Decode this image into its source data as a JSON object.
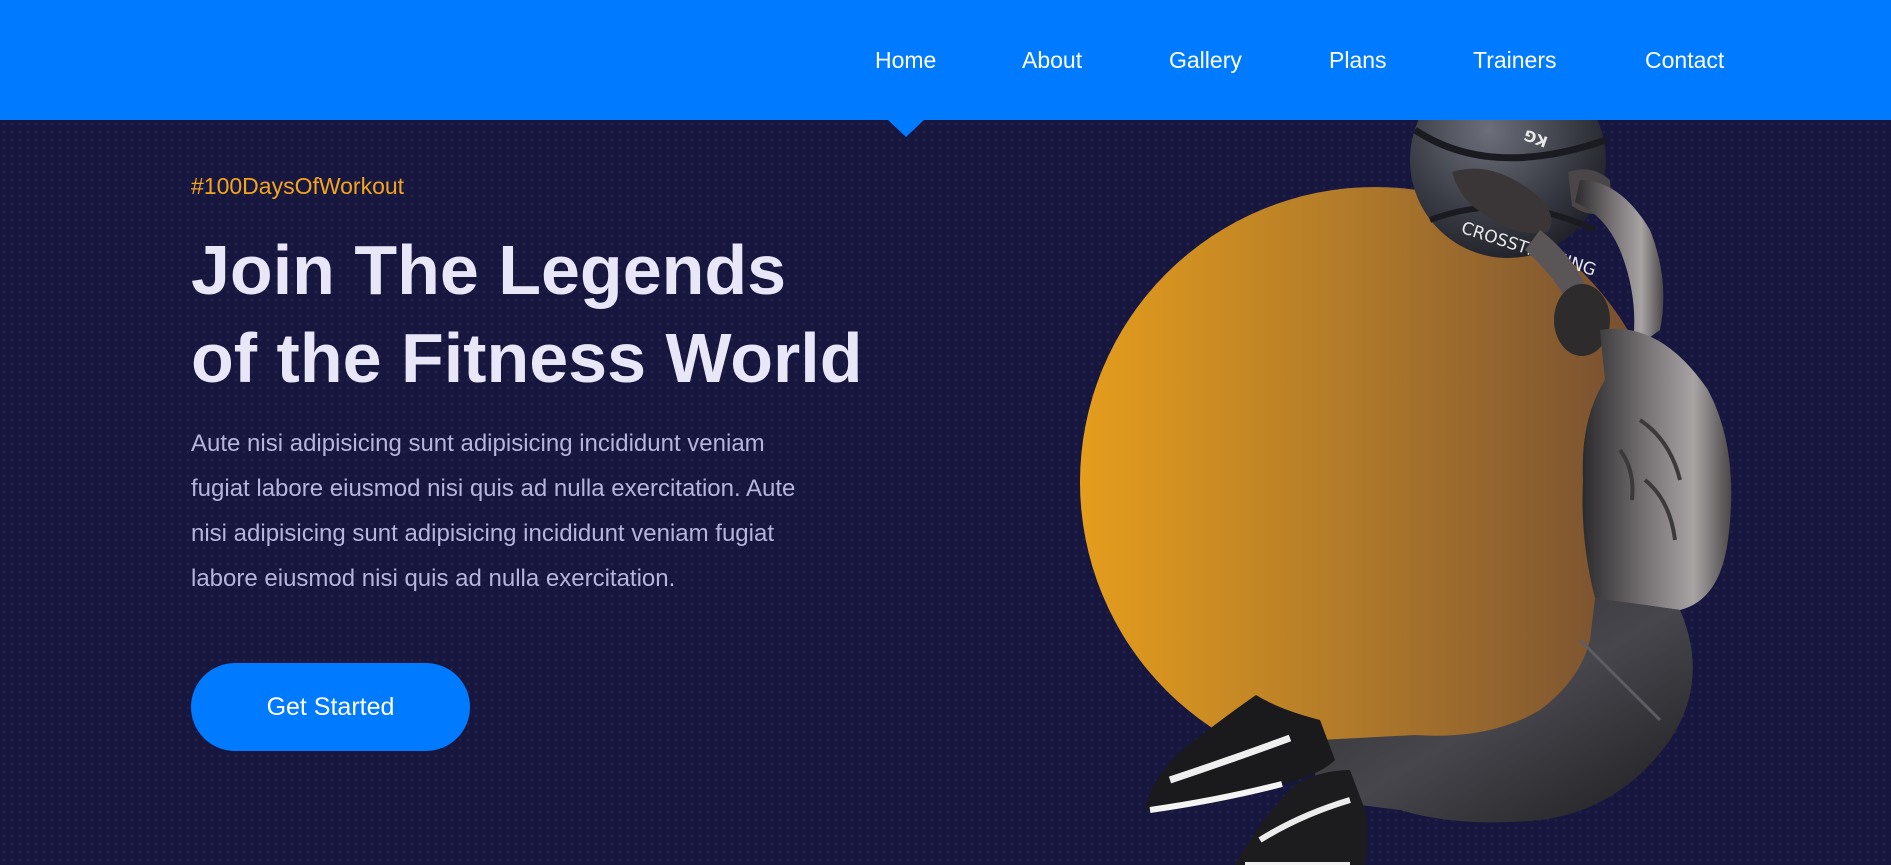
{
  "nav": {
    "items": [
      "Home",
      "About",
      "Gallery",
      "Plans",
      "Trainers",
      "Contact"
    ],
    "active": "Home"
  },
  "hero": {
    "hashtag": "#100DaysOfWorkout",
    "headline": [
      "Join The Legends",
      "of the Fitness World"
    ],
    "description": [
      "Aute nisi adipisicing sunt adipisicing incididunt veniam",
      "fugiat labore eiusmod nisi quis ad nulla exercitation. Aute",
      "nisi adipisicing sunt adipisicing incididunt veniam fugiat",
      "labore eiusmod nisi quis ad nulla exercitation."
    ],
    "cta_label": "Get Started",
    "ball_text": "CROSSTRAINING",
    "ball_weight": "KG"
  },
  "colors": {
    "primary": "#007bff",
    "background": "#17163f",
    "accent": "#f4a51c",
    "heading": "#e8e7f8",
    "body_text": "#b7b5de"
  },
  "icons": {
    "athlete_image": "athlete-with-medicine-ball-image"
  }
}
